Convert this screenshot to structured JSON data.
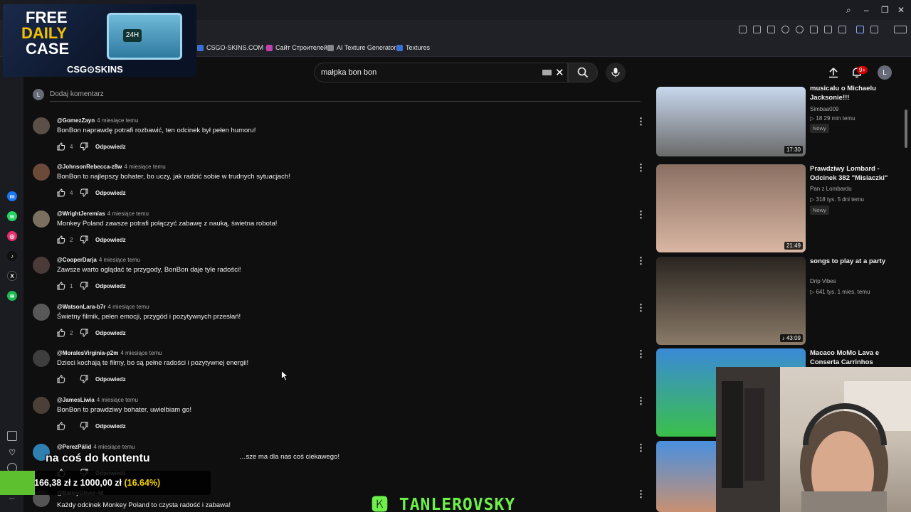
{
  "browser": {
    "bookmarks": [
      {
        "label": "CSGO-SKINS.COM -...",
        "color": "#3b6fd6"
      },
      {
        "label": "Сайт Строителей",
        "color": "#c040b0"
      },
      {
        "label": "AI Texture Generator...",
        "color": "#888888"
      },
      {
        "label": "Textures",
        "color": "#3b6fd6"
      }
    ]
  },
  "ad": {
    "line1": "FREE",
    "line2": "DAILY",
    "line3": "CASE",
    "box_label": "24H",
    "brand": "CSG⊙SKINS"
  },
  "search": {
    "value": "małpka bon bon"
  },
  "header": {
    "notification_count": "9+",
    "avatar_letter": "L"
  },
  "add_comment": {
    "avatar_letter": "L",
    "placeholder": "Dodaj komentarz"
  },
  "comments": [
    {
      "author": "@GomezZayn",
      "time": "4 miesiące temu",
      "text": "BonBon naprawdę potrafi rozbawić, ten odcinek był pełen humoru!",
      "likes": "4",
      "reply": "Odpowiedz",
      "avatar_color": "#5a5048"
    },
    {
      "author": "@JohnsonRebecca-z8w",
      "time": "4 miesiące temu",
      "text": "BonBon to najlepszy bohater, bo uczy, jak radzić sobie w trudnych sytuacjach!",
      "likes": "4",
      "reply": "Odpowiedz",
      "avatar_color": "#6b4a3a"
    },
    {
      "author": "@WrightJeremías",
      "time": "4 miesiące temu",
      "text": "Monkey Poland zawsze potrafi połączyć zabawę z nauką, świetna robota!",
      "likes": "2",
      "reply": "Odpowiedz",
      "avatar_color": "#7a7060"
    },
    {
      "author": "@CooperDarja",
      "time": "4 miesiące temu",
      "text": "Zawsze warto oglądać te przygody, BonBon daje tyle radości!",
      "likes": "1",
      "reply": "Odpowiedz",
      "avatar_color": "#4a3a38"
    },
    {
      "author": "@WatsonLara-b7r",
      "time": "4 miesiące temu",
      "text": "Świetny filmik, pełen emocji, przygód i pozytywnych przesłań!",
      "likes": "2",
      "reply": "Odpowiedz",
      "avatar_color": "#585858"
    },
    {
      "author": "@MoralesVirginia-p2m",
      "time": "4 miesiące temu",
      "text": "Dzieci kochają te filmy, bo są pełne radości i pozytywnej energii!",
      "likes": "",
      "reply": "Odpowiedz",
      "avatar_color": "#3e3e3e"
    },
    {
      "author": "@JamesLiwia",
      "time": "4 miesiące temu",
      "text": "BonBon to prawdziwy bohater, uwielbiam go!",
      "likes": "",
      "reply": "Odpowiedz",
      "avatar_color": "#4a4038"
    },
    {
      "author": "@PerezPálid",
      "time": "4 miesiące temu",
      "text": "…sze ma dla nas coś ciekawego!",
      "likes": "",
      "reply": "Odpowiedz",
      "avatar_color": "#2f7fb0"
    },
    {
      "author": "@BaileyOliver-4il",
      "time": "",
      "text": "Każdy odcinek Monkey Poland to czysta radość i zabawa!",
      "likes": "",
      "reply": "",
      "avatar_color": "#555555"
    }
  ],
  "recommendations": [
    {
      "title": "musicalu o Michaelu Jacksonie!!!",
      "channel": "Simbaa009",
      "meta": "▷ 18  29 min temu",
      "badge": "Nowy",
      "duration": "17:30",
      "thumb_top": "#c8d8ee",
      "thumb_bottom": "#6a6a6a"
    },
    {
      "title": "Prawdziwy Lombard - Odcinek 382 \"Misiaczki\"",
      "channel": "Pan z Lombardu",
      "meta": "▷ 318 tys.  5 dni temu",
      "badge": "Nowy",
      "duration": "21:49",
      "thumb_top": "#8a6f62",
      "thumb_bottom": "#d9b6a3"
    },
    {
      "title": "songs to play at a party",
      "channel": "Drip Vibes",
      "meta": "▷ 641 tys.  1 mies. temu",
      "badge": "",
      "duration": "♪ 43:09",
      "thumb_top": "#2a2520",
      "thumb_bottom": "#8a7a68"
    },
    {
      "title": "Macaco MoMo Lava e Conserta Carrinhos",
      "channel": "",
      "meta": "",
      "badge": "",
      "duration": "",
      "thumb_top": "#3a8ad8",
      "thumb_bottom": "#3ac04a"
    },
    {
      "title": "",
      "channel": "",
      "meta": "",
      "badge": "",
      "duration": "",
      "thumb_top": "#4a90e0",
      "thumb_bottom": "#c89070"
    }
  ],
  "overlay": {
    "subtitle": "na coś do kontentu",
    "donation_amount": "166,38 zł  z  1000,00 zł ",
    "donation_percent": "(16.64%)",
    "streamer": "🅺 TANLEROVSKY"
  }
}
